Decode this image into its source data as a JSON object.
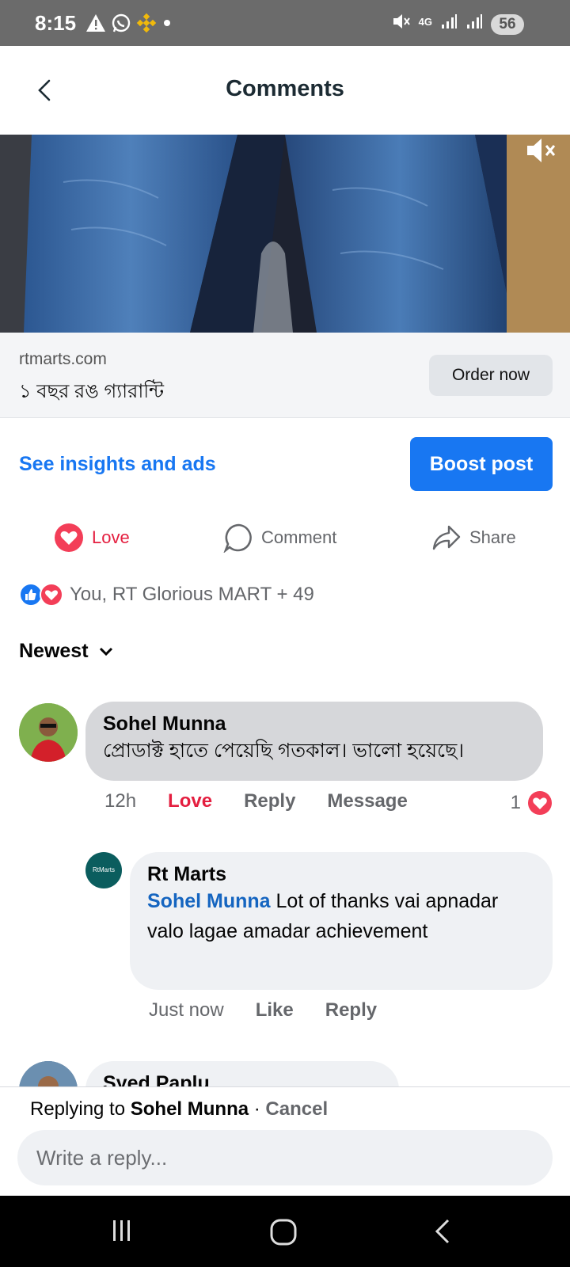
{
  "status_bar": {
    "time": "8:15",
    "network": "4G",
    "battery": "56"
  },
  "header": {
    "title": "Comments"
  },
  "ad": {
    "domain": "rtmarts.com",
    "headline": "১ বছর রঙ গ্যারান্টি",
    "cta": "Order now"
  },
  "promo": {
    "insights": "See insights and ads",
    "boost": "Boost post"
  },
  "actions": {
    "love": "Love",
    "comment": "Comment",
    "share": "Share"
  },
  "reactions": {
    "summary": "You, RT Glorious MART + 49"
  },
  "sort": {
    "label": "Newest"
  },
  "comments": [
    {
      "author": "Sohel Munna",
      "text": "প্রোডাক্ট হাতে পেয়েছি গতকাল। ভালো হয়েছে।",
      "time": "12h",
      "reaction_label": "Love",
      "reply": "Reply",
      "message": "Message",
      "reaction_count": "1"
    },
    {
      "author": "Rt Marts",
      "mention": "Sohel Munna",
      "text": " Lot of thanks vai apnadar valo lagae amadar achievement",
      "time": "Just now",
      "like": "Like",
      "reply": "Reply",
      "avatar_text": "RtMarts"
    },
    {
      "author": "Syed Paplu"
    }
  ],
  "reply_bar": {
    "prefix": "Replying to ",
    "target": "Sohel Munna",
    "separator": " · ",
    "cancel": "Cancel",
    "placeholder": "Write a reply..."
  }
}
